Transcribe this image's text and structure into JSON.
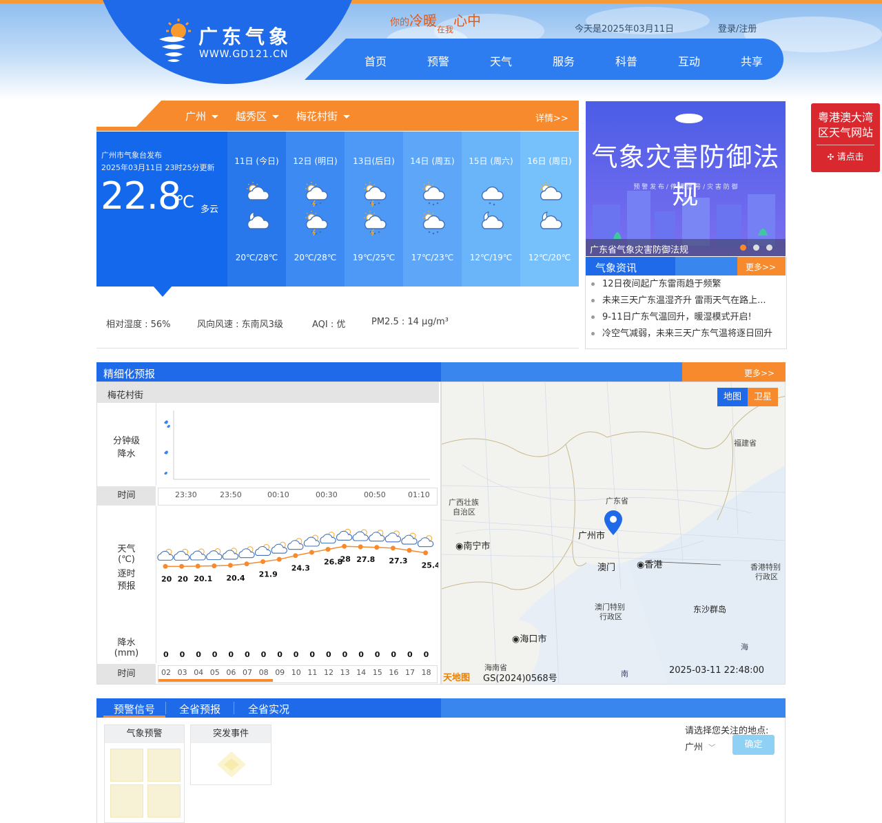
{
  "header": {
    "logo_title": "广东气象",
    "logo_url_text": "WWW.GD121.CN",
    "slogan_a": "你的",
    "slogan_b": "冷暖",
    "slogan_c": "在我",
    "slogan_d": "心中",
    "date_text": "今天是2025年03月11日",
    "login_text": "登录/注册",
    "nav": [
      "首页",
      "预警",
      "天气",
      "服务",
      "科普",
      "互动",
      "共享"
    ]
  },
  "location_bar": {
    "city": "广州",
    "district": "越秀区",
    "street": "梅花村街",
    "detail_link": "详情>>"
  },
  "current": {
    "issuer": "广州市气象台发布",
    "update_time": "2025年03月11日 23时25分更新",
    "temp": "22.8",
    "unit": "℃",
    "condition": "多云"
  },
  "days": [
    {
      "label": "11日 (今日)",
      "temp": "20℃/28℃",
      "day_icon": "partly-cloudy-icon",
      "night_icon": "cloudy-night-icon"
    },
    {
      "label": "12日 (明日)",
      "temp": "20℃/28℃",
      "day_icon": "thunder-shower-icon",
      "night_icon": "thunder-shower-icon"
    },
    {
      "label": "13日(后日)",
      "temp": "19℃/25℃",
      "day_icon": "thunder-shower-icon",
      "night_icon": "thunder-shower-icon"
    },
    {
      "label": "14日 (周五)",
      "temp": "17℃/23℃",
      "day_icon": "shower-icon",
      "night_icon": "shower-icon"
    },
    {
      "label": "15日 (周六)",
      "temp": "12℃/19℃",
      "day_icon": "light-rain-icon",
      "night_icon": "cloudy-night-icon"
    },
    {
      "label": "16日 (周日)",
      "temp": "12℃/20℃",
      "day_icon": "partly-cloudy-icon",
      "night_icon": "cloudy-night-icon"
    }
  ],
  "stats": {
    "humidity": "相对湿度 : 56%",
    "wind": "风向风速 : 东南风3级",
    "aqi": "AQI : 优",
    "pm25": "PM2.5 : 14 μg/m³"
  },
  "banner": {
    "headline": "气象灾害防御法规",
    "sub": "预 警 发 布 / 停 课 信 号 / 灾 害 防 御",
    "caption": "广东省气象灾害防御法规"
  },
  "news": {
    "title": "气象资讯",
    "more": "更多>>",
    "items": [
      "12日夜间起广东雷雨趋于频繁",
      "未来三天广东温湿齐升 雷雨天气在路上...",
      "9-11日广东气温回升，暖湿模式开启!",
      "冷空气减弱，未来三天广东气温将逐日回升"
    ]
  },
  "side_ad": {
    "line1": "粤港澳大湾",
    "line2": "区天气网站",
    "button": "请点击"
  },
  "fine_forecast": {
    "title": "精细化预报",
    "more": "更多>>",
    "location": "梅花村街",
    "minute_label_1": "分钟级",
    "minute_label_2": "降水",
    "time_label": "时间",
    "minute_ticks": [
      "23:30",
      "23:50",
      "00:10",
      "00:30",
      "00:50",
      "01:10"
    ],
    "hourly_label_1": "天气",
    "hourly_label_2": "(℃)",
    "hourly_label_3": "逐时",
    "hourly_label_4": "预报",
    "precip_label_1": "降水",
    "precip_label_2": "(mm)",
    "hours": [
      "02",
      "03",
      "04",
      "05",
      "06",
      "07",
      "08",
      "09",
      "10",
      "11",
      "12",
      "13",
      "14",
      "15",
      "16",
      "17",
      "18"
    ],
    "hour_temps": [
      20,
      20,
      20.1,
      20.2,
      20.4,
      21,
      21.9,
      22.8,
      24.3,
      25.6,
      26.8,
      28,
      27.8,
      27.6,
      27.3,
      26.4,
      25.4
    ],
    "temp_labels": [
      {
        "i": 0,
        "text": "20"
      },
      {
        "i": 1,
        "text": "20"
      },
      {
        "i": 2,
        "text": "20.1"
      },
      {
        "i": 4,
        "text": "20.4"
      },
      {
        "i": 6,
        "text": "21.9"
      },
      {
        "i": 8,
        "text": "24.3"
      },
      {
        "i": 10,
        "text": "26.8"
      },
      {
        "i": 11,
        "text": "28"
      },
      {
        "i": 12,
        "text": "27.8"
      },
      {
        "i": 14,
        "text": "27.3"
      },
      {
        "i": 16,
        "text": "25.4"
      }
    ],
    "precip": [
      "0",
      "0",
      "0",
      "0",
      "0",
      "0",
      "0",
      "0",
      "0",
      "0",
      "0",
      "0",
      "0",
      "0",
      "0",
      "0",
      "0"
    ]
  },
  "map": {
    "btn_map": "地图",
    "btn_satellite": "卫星",
    "labels": {
      "guangxi": "广西壮族",
      "guangxi2": "自治区",
      "guangdong": "广东省",
      "fujian": "福建省",
      "guangzhou": "广州市",
      "nanning": "南宁市",
      "macau": "澳门",
      "hongkong": "香港",
      "hk_sar": "香港特别",
      "hk_sar2": "行政区",
      "macau_sar": "澳门特别",
      "macau_sar2": "行政区",
      "dongsha": "东沙群岛",
      "haikou": "海口市",
      "hainan": "海南省",
      "sea": "海",
      "south": "南"
    },
    "provider": "天地图",
    "license": "GS(2024)0568号",
    "timestamp": "2025-03-11 22:48:00"
  },
  "warning": {
    "tabs": [
      "预警信号",
      "全省预报",
      "全省实况"
    ],
    "card1_title": "气象预警",
    "card2_title": "突发事件",
    "select_prompt": "请选择您关注的地点:",
    "selected_city": "广州",
    "confirm": "确定"
  },
  "colors": {
    "primary_blue": "#1f6ae8",
    "orange": "#f68a2c",
    "temp_line": "#f68a2c"
  }
}
